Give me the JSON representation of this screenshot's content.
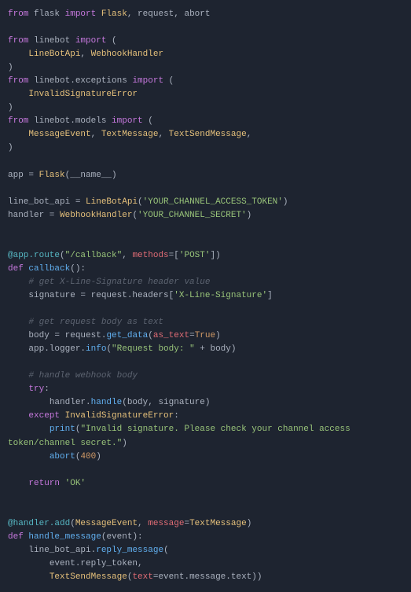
{
  "lines": [
    [
      [
        "kw",
        "from"
      ],
      [
        "op",
        " flask "
      ],
      [
        "kw",
        "import"
      ],
      [
        "op",
        " "
      ],
      [
        "cls",
        "Flask"
      ],
      [
        "op",
        ", request, abort"
      ]
    ],
    [],
    [
      [
        "kw",
        "from"
      ],
      [
        "op",
        " linebot "
      ],
      [
        "kw",
        "import"
      ],
      [
        "op",
        " ("
      ]
    ],
    [
      [
        "op",
        "    "
      ],
      [
        "cls",
        "LineBotApi"
      ],
      [
        "op",
        ", "
      ],
      [
        "cls",
        "WebhookHandler"
      ]
    ],
    [
      [
        "op",
        ")"
      ]
    ],
    [
      [
        "kw",
        "from"
      ],
      [
        "op",
        " linebot.exceptions "
      ],
      [
        "kw",
        "import"
      ],
      [
        "op",
        " ("
      ]
    ],
    [
      [
        "op",
        "    "
      ],
      [
        "cls",
        "InvalidSignatureError"
      ]
    ],
    [
      [
        "op",
        ")"
      ]
    ],
    [
      [
        "kw",
        "from"
      ],
      [
        "op",
        " linebot.models "
      ],
      [
        "kw",
        "import"
      ],
      [
        "op",
        " ("
      ]
    ],
    [
      [
        "op",
        "    "
      ],
      [
        "cls",
        "MessageEvent"
      ],
      [
        "op",
        ", "
      ],
      [
        "cls",
        "TextMessage"
      ],
      [
        "op",
        ", "
      ],
      [
        "cls",
        "TextSendMessage"
      ],
      [
        "op",
        ","
      ]
    ],
    [
      [
        "op",
        ")"
      ]
    ],
    [],
    [
      [
        "op",
        "app = "
      ],
      [
        "cls",
        "Flask"
      ],
      [
        "op",
        "(__name__)"
      ]
    ],
    [],
    [
      [
        "op",
        "line_bot_api = "
      ],
      [
        "cls",
        "LineBotApi"
      ],
      [
        "op",
        "("
      ],
      [
        "str",
        "'YOUR_CHANNEL_ACCESS_TOKEN'"
      ],
      [
        "op",
        ")"
      ]
    ],
    [
      [
        "op",
        "handler = "
      ],
      [
        "cls",
        "WebhookHandler"
      ],
      [
        "op",
        "("
      ],
      [
        "str",
        "'YOUR_CHANNEL_SECRET'"
      ],
      [
        "op",
        ")"
      ]
    ],
    [],
    [],
    [
      [
        "fn",
        "@app.route"
      ],
      [
        "op",
        "("
      ],
      [
        "str",
        "\"/callback\""
      ],
      [
        "op",
        ", "
      ],
      [
        "var",
        "methods"
      ],
      [
        "op",
        "=["
      ],
      [
        "str",
        "'POST'"
      ],
      [
        "op",
        "])"
      ]
    ],
    [
      [
        "kw",
        "def"
      ],
      [
        "op",
        " "
      ],
      [
        "call",
        "callback"
      ],
      [
        "op",
        "():"
      ]
    ],
    [
      [
        "op",
        "    "
      ],
      [
        "cmt",
        "# get X-Line-Signature header value"
      ]
    ],
    [
      [
        "op",
        "    signature = request.headers["
      ],
      [
        "str",
        "'X-Line-Signature'"
      ],
      [
        "op",
        "]"
      ]
    ],
    [],
    [
      [
        "op",
        "    "
      ],
      [
        "cmt",
        "# get request body as text"
      ]
    ],
    [
      [
        "op",
        "    body = request."
      ],
      [
        "call",
        "get_data"
      ],
      [
        "op",
        "("
      ],
      [
        "var",
        "as_text"
      ],
      [
        "op",
        "="
      ],
      [
        "bool",
        "True"
      ],
      [
        "op",
        ")"
      ]
    ],
    [
      [
        "op",
        "    app.logger."
      ],
      [
        "call",
        "info"
      ],
      [
        "op",
        "("
      ],
      [
        "str",
        "\"Request body: \""
      ],
      [
        "op",
        " + body)"
      ]
    ],
    [],
    [
      [
        "op",
        "    "
      ],
      [
        "cmt",
        "# handle webhook body"
      ]
    ],
    [
      [
        "op",
        "    "
      ],
      [
        "kw",
        "try"
      ],
      [
        "op",
        ":"
      ]
    ],
    [
      [
        "op",
        "        handler."
      ],
      [
        "call",
        "handle"
      ],
      [
        "op",
        "(body, signature)"
      ]
    ],
    [
      [
        "op",
        "    "
      ],
      [
        "kw",
        "except"
      ],
      [
        "op",
        " "
      ],
      [
        "cls",
        "InvalidSignatureError"
      ],
      [
        "op",
        ":"
      ]
    ],
    [
      [
        "op",
        "        "
      ],
      [
        "call",
        "print"
      ],
      [
        "op",
        "("
      ],
      [
        "str",
        "\"Invalid signature. Please check your channel access token/channel secret.\""
      ],
      [
        "op",
        ")"
      ]
    ],
    [
      [
        "op",
        "        "
      ],
      [
        "call",
        "abort"
      ],
      [
        "op",
        "("
      ],
      [
        "num",
        "400"
      ],
      [
        "op",
        ")"
      ]
    ],
    [],
    [
      [
        "op",
        "    "
      ],
      [
        "kw",
        "return"
      ],
      [
        "op",
        " "
      ],
      [
        "str",
        "'OK'"
      ]
    ],
    [],
    [],
    [
      [
        "fn",
        "@handler.add"
      ],
      [
        "op",
        "("
      ],
      [
        "cls",
        "MessageEvent"
      ],
      [
        "op",
        ", "
      ],
      [
        "var",
        "message"
      ],
      [
        "op",
        "="
      ],
      [
        "cls",
        "TextMessage"
      ],
      [
        "op",
        ")"
      ]
    ],
    [
      [
        "kw",
        "def"
      ],
      [
        "op",
        " "
      ],
      [
        "call",
        "handle_message"
      ],
      [
        "op",
        "(event):"
      ]
    ],
    [
      [
        "op",
        "    line_bot_api."
      ],
      [
        "call",
        "reply_message"
      ],
      [
        "op",
        "("
      ]
    ],
    [
      [
        "op",
        "        event.reply_token,"
      ]
    ],
    [
      [
        "op",
        "        "
      ],
      [
        "cls",
        "TextSendMessage"
      ],
      [
        "op",
        "("
      ],
      [
        "var",
        "text"
      ],
      [
        "op",
        "=event.message.text))"
      ]
    ]
  ]
}
